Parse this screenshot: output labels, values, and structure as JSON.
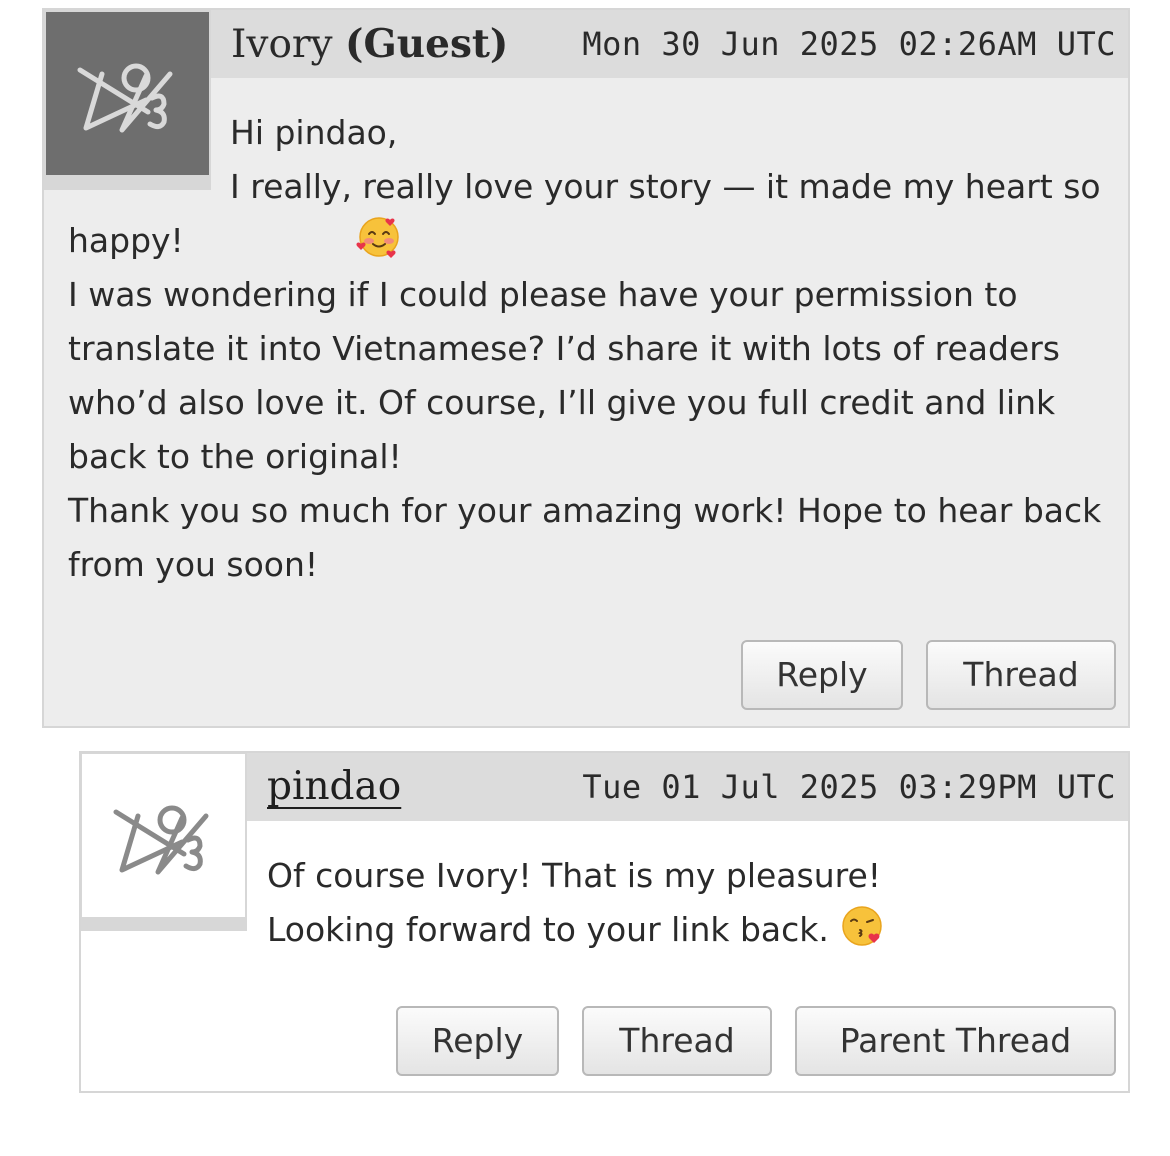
{
  "comments": [
    {
      "author": "Ivory",
      "author_badge": "(Guest)",
      "timestamp": "Mon 30 Jun 2025 02:26AM UTC",
      "avatar_icon": "default-avatar-icon",
      "lines": [
        "Hi pindao,",
        "I really, really love your story — it made my heart so happy!",
        "I was wondering if I could please have your permission to translate it into Vietnamese? I’d share it with lots of readers who’d also love it. Of course, I’ll give you full credit and link back to the original!",
        "Thank you so much for your amazing work! Hope to hear back from you soon!"
      ],
      "emoji": "smiling-face-with-hearts-emoji",
      "buttons": {
        "reply": "Reply",
        "thread": "Thread"
      }
    },
    {
      "author": "pindao",
      "timestamp": "Tue 01 Jul 2025 03:29PM UTC",
      "avatar_icon": "default-avatar-icon",
      "lines": [
        "Of course Ivory! That is my pleasure!",
        "Looking forward to your link back."
      ],
      "emoji": "face-blowing-kiss-emoji",
      "buttons": {
        "reply": "Reply",
        "thread": "Thread",
        "parent_thread": "Parent Thread"
      }
    }
  ],
  "colors": {
    "comment_bg_guest": "#ededed",
    "comment_bg_reply": "#ffffff",
    "header_bg": "#dcdcdc",
    "avatar_dark_bg": "#6e6e6e"
  }
}
